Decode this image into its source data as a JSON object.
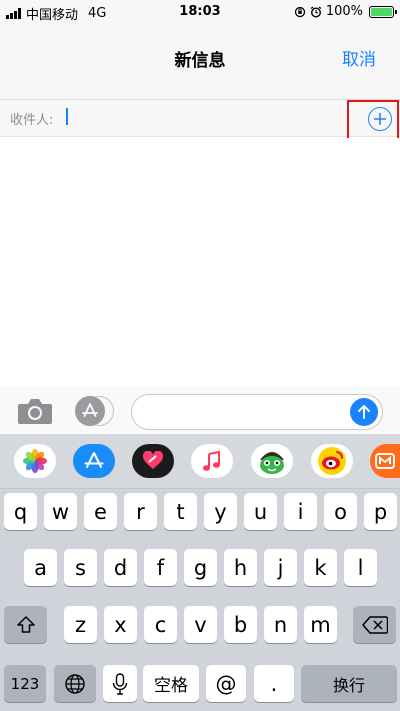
{
  "status_bar": {
    "carrier": "中国移动",
    "network": "4G",
    "time": "18:03",
    "battery_percent": "100%",
    "battery_level": 1.0
  },
  "header": {
    "title": "新信息",
    "cancel_label": "取消"
  },
  "recipient": {
    "label": "收件人:",
    "value": ""
  },
  "compose": {
    "message_value": ""
  },
  "keyboard": {
    "row1": [
      "q",
      "w",
      "e",
      "r",
      "t",
      "y",
      "u",
      "i",
      "o",
      "p"
    ],
    "row2": [
      "a",
      "s",
      "d",
      "f",
      "g",
      "h",
      "j",
      "k",
      "l"
    ],
    "row3": [
      "z",
      "x",
      "c",
      "v",
      "b",
      "n",
      "m"
    ],
    "numbers_label": "123",
    "space_label": "空格",
    "at_label": "@",
    "dot_label": ".",
    "return_label": "换行"
  },
  "app_strip": [
    {
      "name": "photos-app",
      "color": "#ffffff"
    },
    {
      "name": "app-store-app",
      "color": "#1a8cf8"
    },
    {
      "name": "digital-touch-app",
      "color": "#1b1b1b"
    },
    {
      "name": "music-app",
      "color": "#ffffff"
    },
    {
      "name": "game-app",
      "color": "#ffffff"
    },
    {
      "name": "weibo-app",
      "color": "#ffffff"
    },
    {
      "name": "mango-tv-app",
      "color": "#ff6b1a"
    }
  ],
  "colors": {
    "accent": "#1a82fb",
    "highlight_box": "#e0191c",
    "keyboard_bg": "#d0d3d9"
  },
  "icons": {
    "camera": "camera-icon",
    "app_store": "app-store-icon",
    "send": "arrow-up-icon",
    "add_contact": "plus-circle-icon",
    "shift": "shift-icon",
    "delete": "backspace-icon",
    "globe": "globe-icon",
    "microphone": "microphone-icon"
  }
}
